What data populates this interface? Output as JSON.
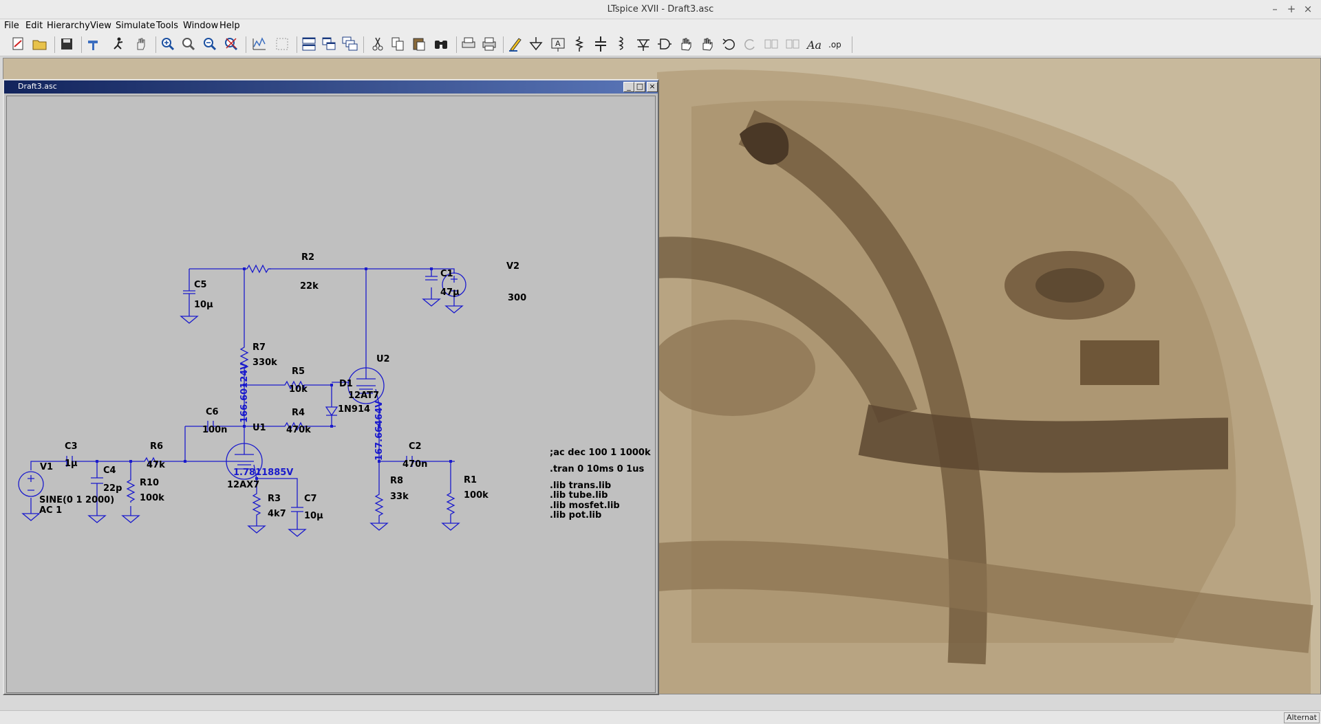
{
  "window": {
    "title": "LTspice XVII - Draft3.asc",
    "controls": {
      "minimize": "–",
      "maximize": "+",
      "close": "×"
    }
  },
  "menu": [
    "File",
    "Edit",
    "Hierarchy",
    "View",
    "Simulate",
    "Tools",
    "Window",
    "Help"
  ],
  "toolbar": {
    "buttons": [
      "new-schematic",
      "open",
      "save",
      "control-panel",
      "run",
      "halt",
      "zoom-in",
      "zoom-pan",
      "zoom-out",
      "zoom-fit",
      "autoscale",
      "delete-trace",
      "tile-horizontal",
      "tile-vertical",
      "cascade",
      "cut",
      "copy",
      "paste",
      "find",
      "print-preview",
      "print",
      "draw-wire",
      "ground",
      "label-net",
      "resistor",
      "capacitor",
      "inductor",
      "diode",
      "component",
      "move",
      "drag",
      "undo",
      "redo",
      "rotate",
      "mirror",
      "text",
      "spice-directive"
    ],
    "op_label": ".op"
  },
  "document": {
    "title": "Draft3.asc",
    "controls": {
      "minimize": "_",
      "restore": "□",
      "close": "×"
    }
  },
  "schematic": {
    "components": {
      "R2": {
        "name": "R2",
        "value": "22k"
      },
      "C5": {
        "name": "C5",
        "value": "10µ"
      },
      "C1": {
        "name": "C1",
        "value": "47µ"
      },
      "V2": {
        "name": "V2",
        "value": "300"
      },
      "R7": {
        "name": "R7",
        "value": "330k"
      },
      "U2": {
        "name": "U2",
        "value": "12AT7"
      },
      "R5": {
        "name": "R5",
        "value": "10k"
      },
      "D1": {
        "name": "D1",
        "value": "1N914"
      },
      "R4": {
        "name": "R4",
        "value": "470k"
      },
      "C6": {
        "name": "C6",
        "value": "100n"
      },
      "U1": {
        "name": "U1",
        "value": "12AX7"
      },
      "C3": {
        "name": "C3",
        "value": "1µ"
      },
      "C4": {
        "name": "C4",
        "value": "22p"
      },
      "R6": {
        "name": "R6",
        "value": "47k"
      },
      "R10": {
        "name": "R10",
        "value": "100k"
      },
      "V1": {
        "name": "V1",
        "value": "SINE(0 1 2000)",
        "value2": "AC 1"
      },
      "R3": {
        "name": "R3",
        "value": "4k7"
      },
      "C7": {
        "name": "C7",
        "value": "10µ"
      },
      "R8": {
        "name": "R8",
        "value": "33k"
      },
      "C2": {
        "name": "C2",
        "value": "470n"
      },
      "R1": {
        "name": "R1",
        "value": "100k"
      }
    },
    "voltages": {
      "u1_plate": "166.60124V",
      "u1_cathode": "1.7811885V",
      "u2_cathode": "167.66464V"
    },
    "directives": [
      ";ac dec 100 1 1000k",
      ".tran 0 10ms 0 1us",
      ".lib trans.lib",
      ".lib tube.lib",
      ".lib mosfet.lib",
      ".lib pot.lib"
    ],
    "colors": {
      "wire": "#1a1acc",
      "component": "#1a1acc",
      "junction": "#1a1acc",
      "background": "#c0c0c0"
    }
  },
  "statusbar": {
    "text": "Alternat"
  }
}
